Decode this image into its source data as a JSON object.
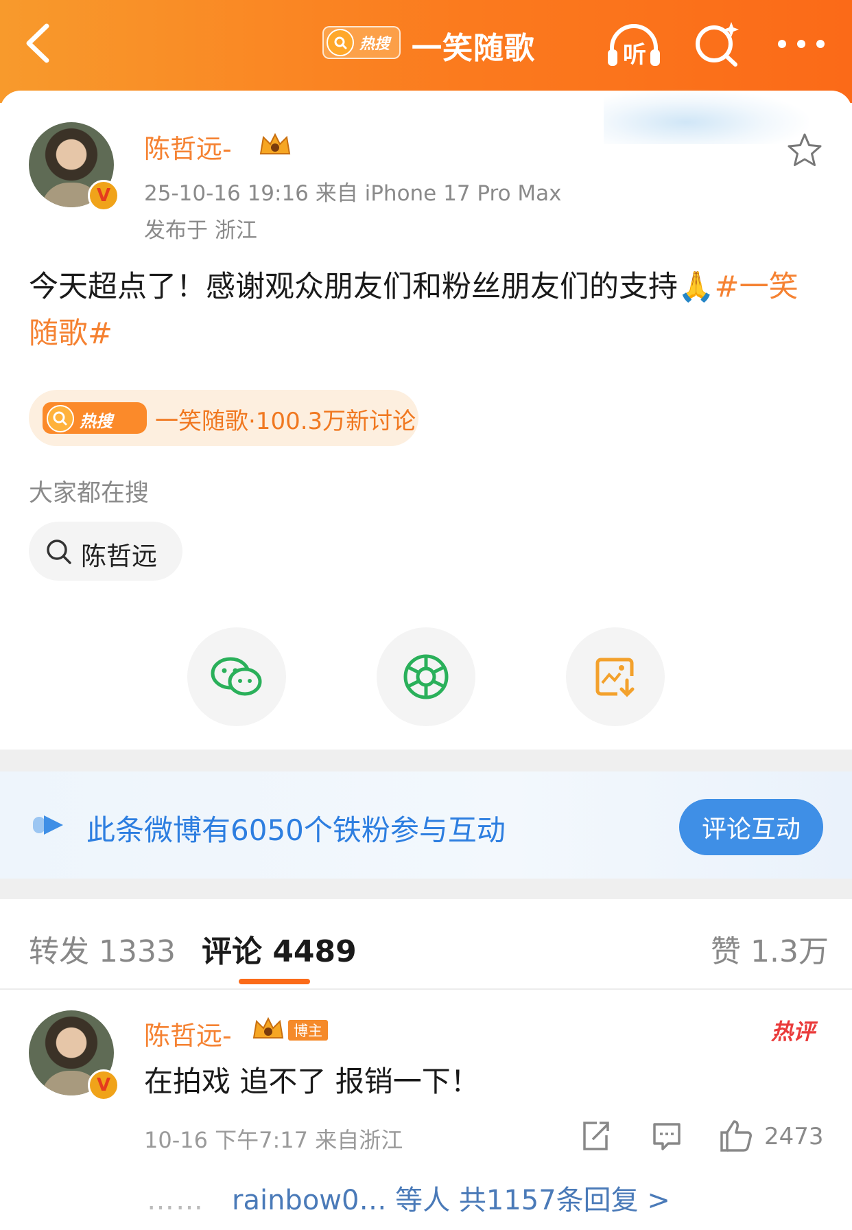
{
  "header": {
    "hot_label": "热搜",
    "title": "一笑随歌",
    "listen_label": "听"
  },
  "post": {
    "author": "陈哲远-",
    "time_source": "25-10-16 19:16  来自 iPhone 17 Pro Max",
    "location": "发布于 浙江",
    "text": "今天超点了！感谢观众朋友们和粉丝朋友们的支持",
    "emoji": "🙏",
    "tag": "#一笑随歌#",
    "hot_pill": {
      "logo_label": "热搜",
      "text": "一笑随歌·100.3万新讨论"
    },
    "everyone_searching_label": "大家都在搜",
    "search_chip": "陈哲远"
  },
  "fans_banner": {
    "text": "此条微博有6050个铁粉参与互动",
    "button": "评论互动"
  },
  "tabs": {
    "repost": "转发 1333",
    "comment": "评论 4489",
    "like": "赞 1.3万"
  },
  "comment": {
    "author": "陈哲远-",
    "badge": "博主",
    "hot_label": "热评",
    "text": "在拍戏 追不了 报销一下！",
    "meta": "10-16  下午7:17  来自浙江",
    "likes": "2473",
    "reply_dots": "……",
    "reply_text": "rainbow0… 等人  共1157条回复 >"
  },
  "colors": {
    "brand_orange": "#fb7a1e",
    "link_orange": "#f58232",
    "banner_blue": "#2d7ee0",
    "hot_red": "#ea3a3a"
  }
}
